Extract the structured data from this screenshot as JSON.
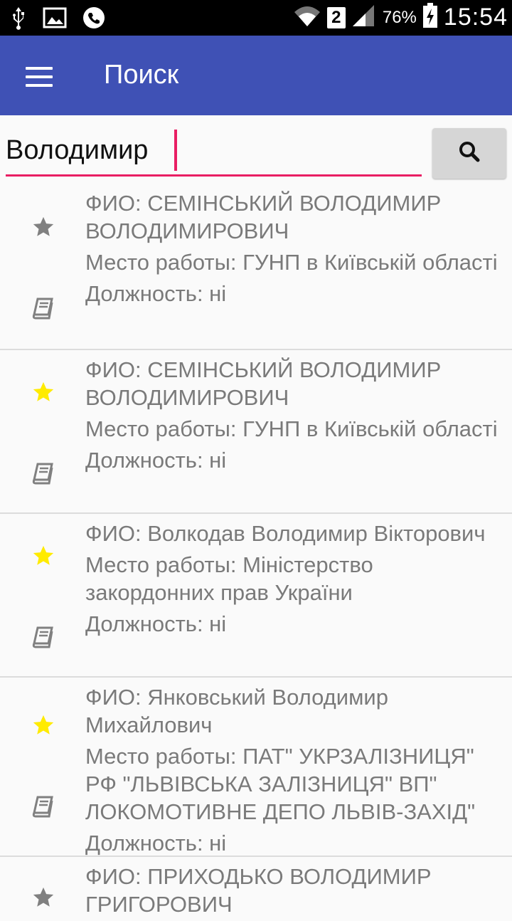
{
  "status_bar": {
    "battery_percent": "76%",
    "time": "15:54",
    "sim_slot": "2",
    "icons_left": [
      "usb-icon",
      "image-icon",
      "phone-icon"
    ],
    "icons_right": [
      "wifi-icon",
      "sim-2-icon",
      "signal-icon",
      "battery-charging-icon"
    ]
  },
  "app_bar": {
    "title": "Поиск",
    "color": "#3f51b5",
    "menu_icon": "hamburger-menu-icon"
  },
  "search": {
    "value": "Володимир",
    "accent_color": "#e91e63",
    "button_icon": "search-icon"
  },
  "results": [
    {
      "name": "ФИО: СЕМІНСЬКИЙ ВОЛОДИМИР ВОЛОДИМИРОВИЧ",
      "work": "Место работы: ГУНП в Київській області",
      "position": "Должность: ні",
      "favorite": false
    },
    {
      "name": "ФИО: СЕМІНСЬКИЙ ВОЛОДИМИР ВОЛОДИМИРОВИЧ",
      "work": "Место работы: ГУНП в Київській області",
      "position": "Должность: ні",
      "favorite": true
    },
    {
      "name": "ФИО: Волкодав Володимир Вікторович",
      "work": "Место работы: Міністерство закордонних прав України",
      "position": "Должность: ні",
      "favorite": true
    },
    {
      "name": "ФИО: Янковський Володимир Михайлович",
      "work": "Место работы: ПАТ\" УКРЗАЛІЗНИЦЯ\" РФ \"ЛЬВІВСЬКА ЗАЛІЗНИЦЯ\" ВП\" ЛОКОМОТИВНЕ ДЕПО ЛЬВІВ-ЗАХІД\"",
      "position": "Должность: ні",
      "favorite": true
    },
    {
      "name": "ФИО: ПРИХОДЬКО ВОЛОДИМИР ГРИГОРОВИЧ",
      "work": "",
      "position": "",
      "favorite": false
    }
  ],
  "colors": {
    "star_active": "#ffeb00",
    "star_inactive": "#808080",
    "text_secondary": "#7a7a7a",
    "divider": "#dcdcdc"
  }
}
